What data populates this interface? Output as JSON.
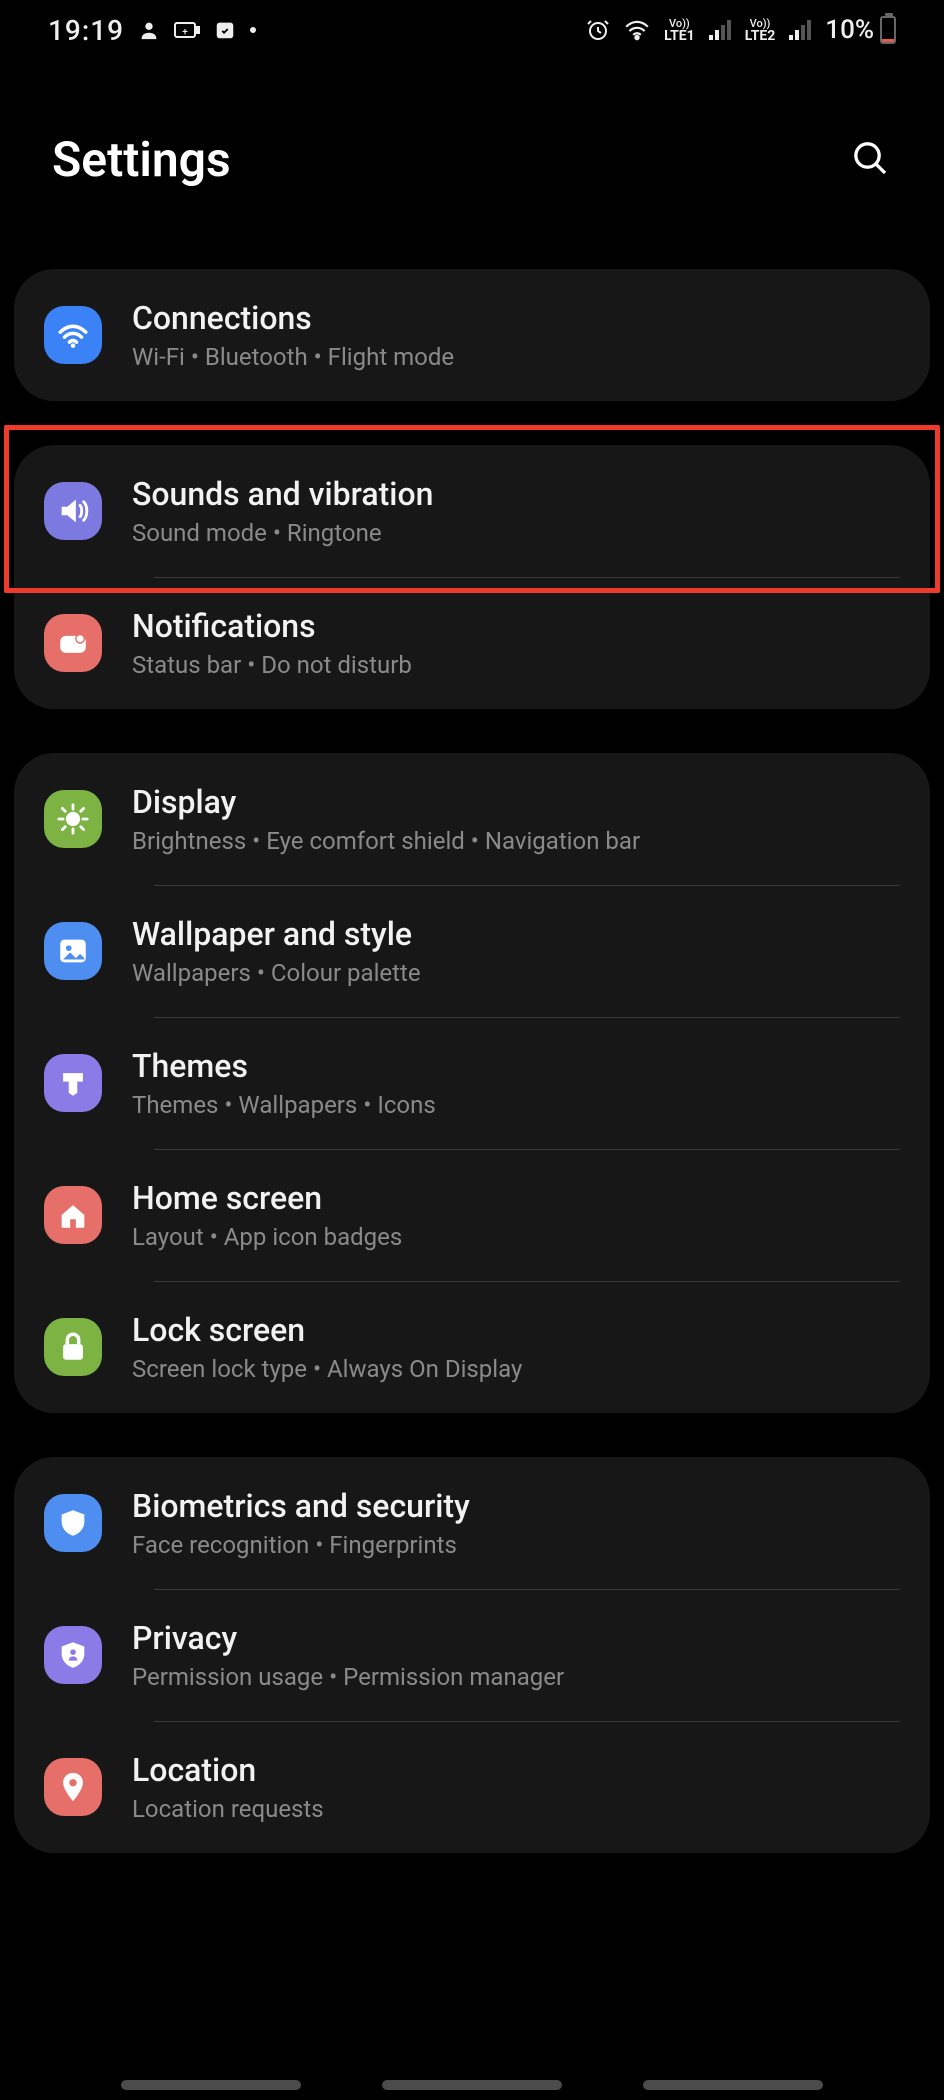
{
  "status": {
    "time": "19:19",
    "battery": "10%",
    "sim1": "LTE1",
    "sim2": "LTE2"
  },
  "header": {
    "title": "Settings"
  },
  "highlight_item": "sounds-and-vibration",
  "groups": [
    {
      "items": [
        {
          "id": "connections",
          "title": "Connections",
          "sub": "Wi-Fi  •  Bluetooth  •  Flight mode",
          "icon": "wifi-icon",
          "color": "bg-blue"
        }
      ]
    },
    {
      "items": [
        {
          "id": "sounds-and-vibration",
          "title": "Sounds and vibration",
          "sub": "Sound mode  •  Ringtone",
          "icon": "speaker-icon",
          "color": "bg-purple"
        },
        {
          "id": "notifications",
          "title": "Notifications",
          "sub": "Status bar  •  Do not disturb",
          "icon": "bell-icon",
          "color": "bg-pink"
        }
      ]
    },
    {
      "items": [
        {
          "id": "display",
          "title": "Display",
          "sub": "Brightness  •  Eye comfort shield  •  Navigation bar",
          "icon": "sun-icon",
          "color": "bg-green"
        },
        {
          "id": "wallpaper-and-style",
          "title": "Wallpaper and style",
          "sub": "Wallpapers  •  Colour palette",
          "icon": "image-icon",
          "color": "bg-lblue"
        },
        {
          "id": "themes",
          "title": "Themes",
          "sub": "Themes  •  Wallpapers  •  Icons",
          "icon": "brush-icon",
          "color": "bg-violet"
        },
        {
          "id": "home-screen",
          "title": "Home screen",
          "sub": "Layout  •  App icon badges",
          "icon": "home-icon",
          "color": "bg-coral"
        },
        {
          "id": "lock-screen",
          "title": "Lock screen",
          "sub": "Screen lock type  •  Always On Display",
          "icon": "lock-icon",
          "color": "bg-lime"
        }
      ]
    },
    {
      "items": [
        {
          "id": "biometrics-and-security",
          "title": "Biometrics and security",
          "sub": "Face recognition  •  Fingerprints",
          "icon": "shield-icon",
          "color": "bg-lblue"
        },
        {
          "id": "privacy",
          "title": "Privacy",
          "sub": "Permission usage  •  Permission manager",
          "icon": "privacy-icon",
          "color": "bg-violet"
        },
        {
          "id": "location",
          "title": "Location",
          "sub": "Location requests",
          "icon": "pin-icon",
          "color": "bg-coral"
        }
      ]
    }
  ]
}
